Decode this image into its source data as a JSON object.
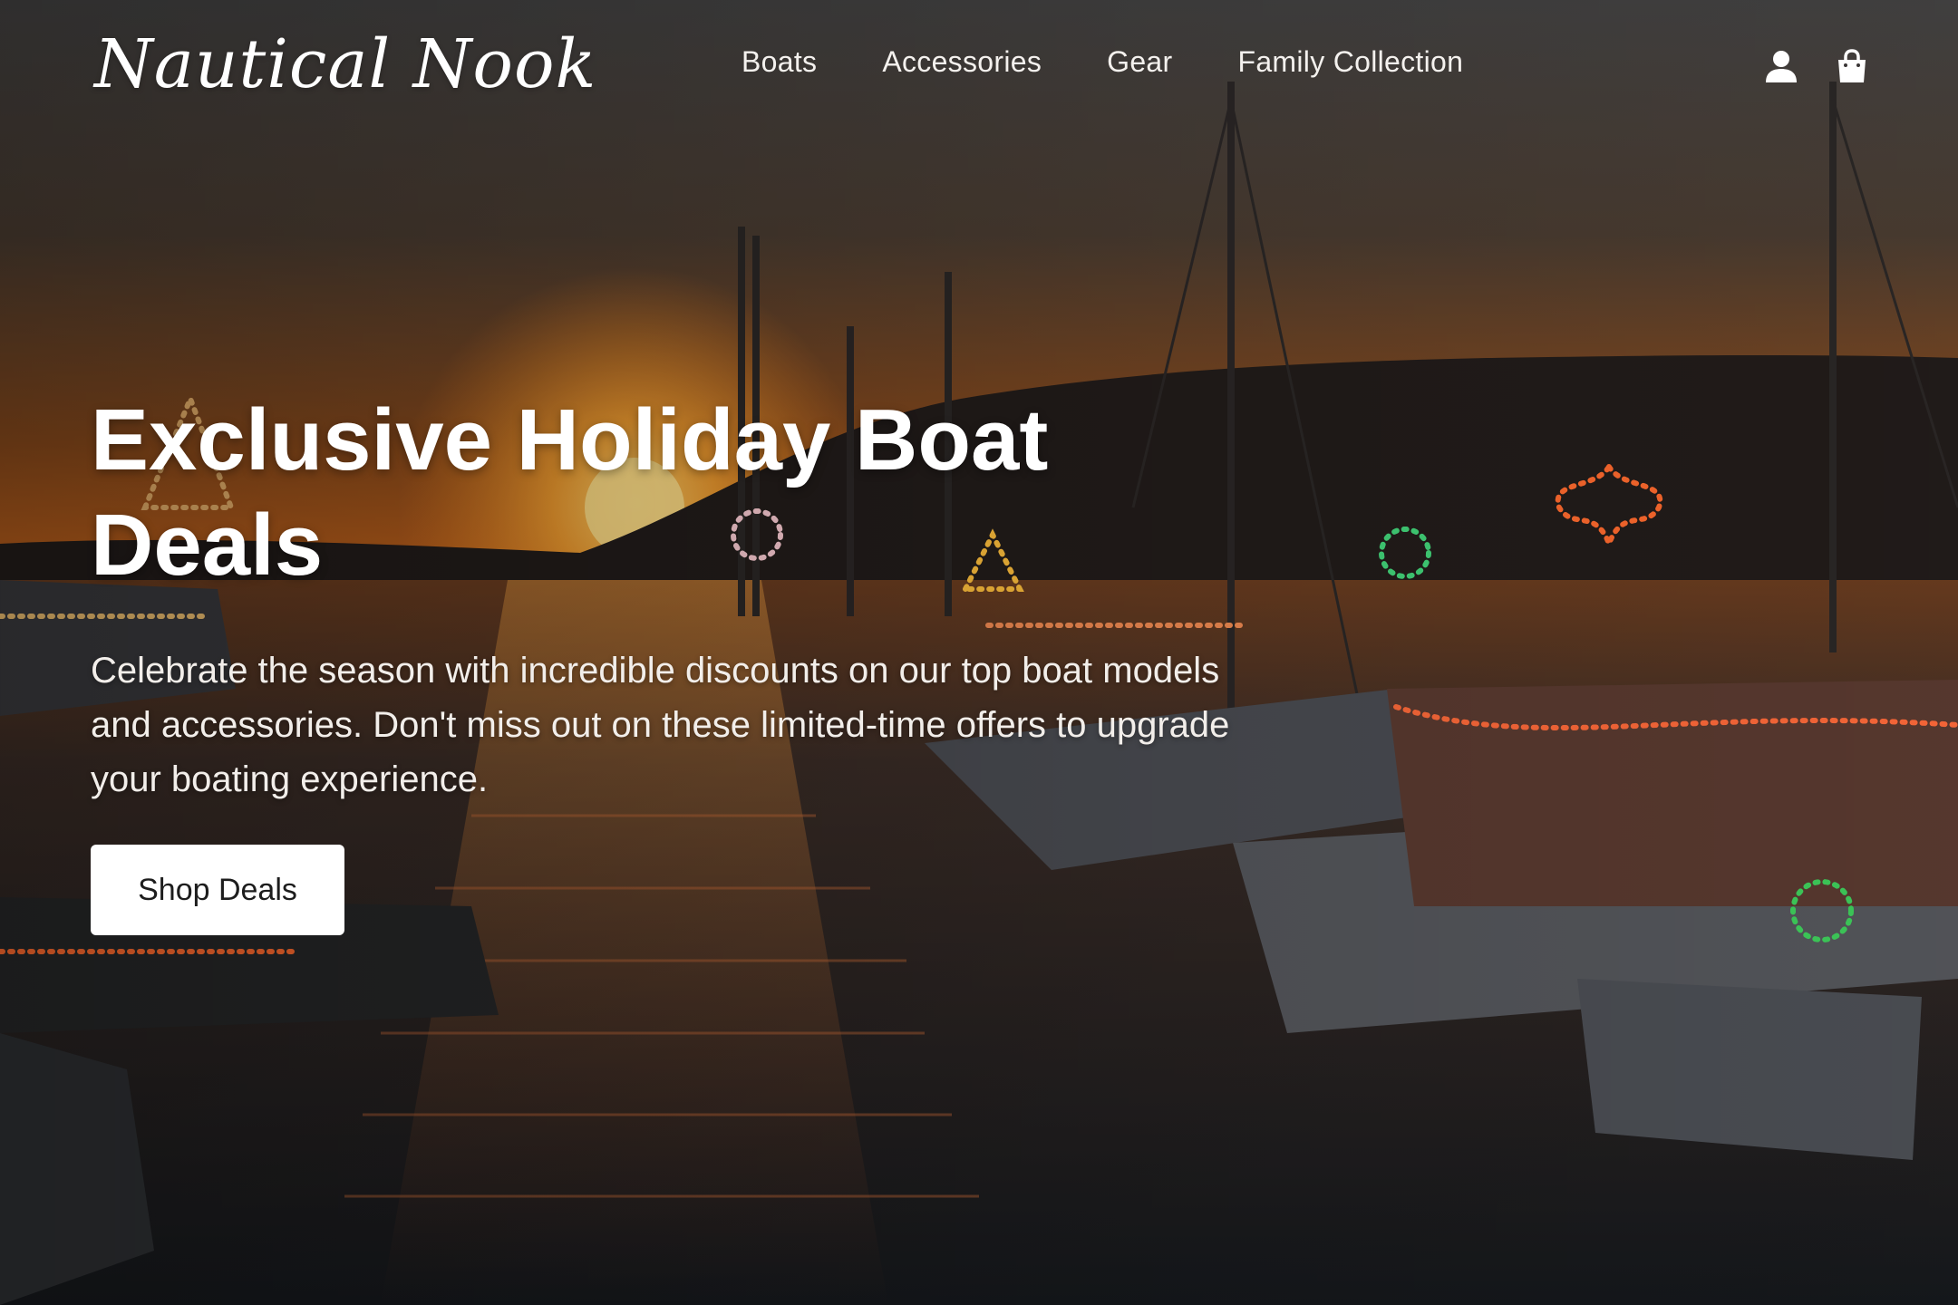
{
  "brand": {
    "logo_text": "Nautical Nook"
  },
  "nav": {
    "items": [
      {
        "label": "Boats"
      },
      {
        "label": "Accessories"
      },
      {
        "label": "Gear"
      },
      {
        "label": "Family Collection"
      }
    ]
  },
  "header_icons": [
    {
      "name": "account-icon"
    },
    {
      "name": "shopping-bag-icon"
    }
  ],
  "hero": {
    "headline": "Exclusive Holiday Boat Deals",
    "subcopy": "Celebrate the season with incredible discounts on our top boat models and accessories. Don't miss out on these limited-time offers to upgrade your boating experience.",
    "cta_label": "Shop Deals",
    "background_description_colors": {
      "sky_top": "#3b3a3b",
      "sunset_orange": "#e07a1e",
      "water": "#1f2226"
    }
  }
}
